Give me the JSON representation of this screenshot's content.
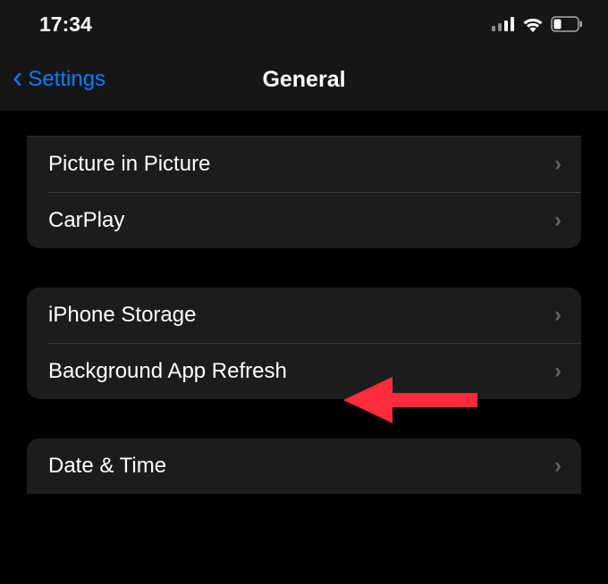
{
  "status": {
    "time": "17:34"
  },
  "nav": {
    "back_label": "Settings",
    "title": "General"
  },
  "section1": {
    "items": [
      {
        "label": "Picture in Picture"
      },
      {
        "label": "CarPlay"
      }
    ]
  },
  "section2": {
    "items": [
      {
        "label": "iPhone Storage"
      },
      {
        "label": "Background App Refresh"
      }
    ]
  },
  "section3": {
    "items": [
      {
        "label": "Date & Time"
      }
    ]
  },
  "annotation": {
    "color": "#ff2a3c"
  }
}
